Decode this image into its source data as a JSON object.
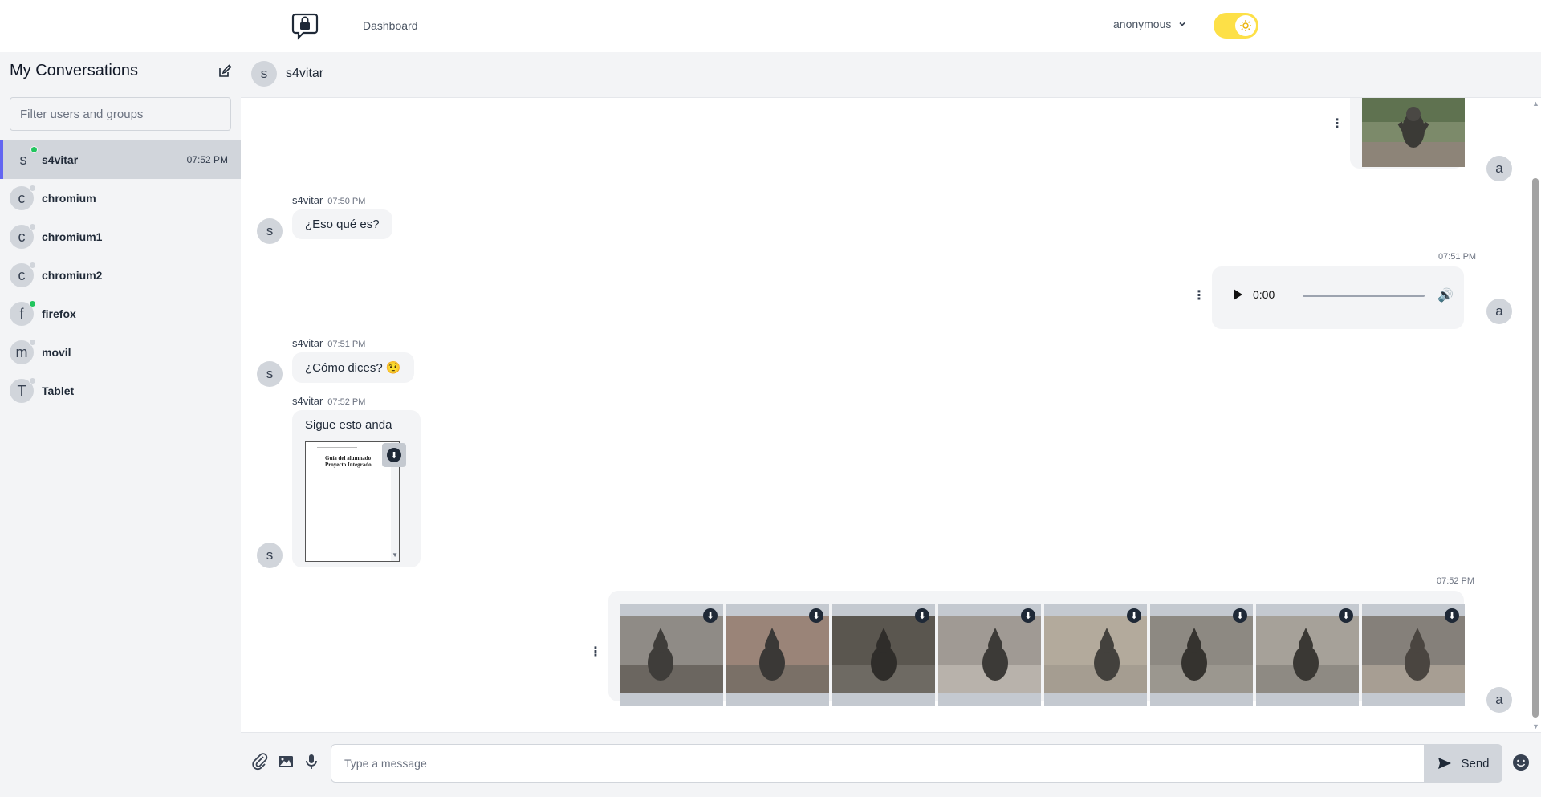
{
  "topbar": {
    "logo_icon": "lock-chat-bubble-icon",
    "nav_dashboard": "Dashboard",
    "user_menu": "anonymous",
    "theme_toggle_icon": "sun-icon"
  },
  "sidebar": {
    "title": "My Conversations",
    "edit_icon": "edit-icon",
    "filter_placeholder": "Filter users and groups",
    "conversations": [
      {
        "initial": "s",
        "name": "s4vitar",
        "time": "07:52 PM",
        "online": true,
        "active": true
      },
      {
        "initial": "c",
        "name": "chromium",
        "time": "",
        "online": false
      },
      {
        "initial": "c",
        "name": "chromium1",
        "time": "",
        "online": false
      },
      {
        "initial": "c",
        "name": "chromium2",
        "time": "",
        "online": false
      },
      {
        "initial": "f",
        "name": "firefox",
        "time": "",
        "online": true
      },
      {
        "initial": "m",
        "name": "movil",
        "time": "",
        "online": false
      },
      {
        "initial": "T",
        "name": "Tablet",
        "time": "",
        "online": false
      }
    ]
  },
  "chat": {
    "header_initial": "s",
    "header_name": "s4vitar",
    "messages": [
      {
        "sender": "s4vitar",
        "time": "07:50 PM",
        "text": "¿Eso qué es?"
      },
      {
        "own": true,
        "time": "07:51 PM",
        "audio_time": "0:00"
      },
      {
        "sender": "s4vitar",
        "time": "07:51 PM",
        "text": "¿Cómo dices? 🤨"
      },
      {
        "sender": "s4vitar",
        "time": "07:52 PM",
        "text": "Sigue esto anda",
        "pdf_line1": "Guía del alumnado",
        "pdf_line2": "Proyecto Integrado"
      },
      {
        "own": true,
        "time": "07:52 PM",
        "photos": 8
      }
    ],
    "self_initial": "a",
    "sender_initial": "s"
  },
  "composer": {
    "placeholder": "Type a message",
    "send_label": "Send"
  },
  "colors": {
    "accent": "#6366f1",
    "online": "#22c55e",
    "offline": "#d1d5db",
    "toggle": "#fde047"
  }
}
